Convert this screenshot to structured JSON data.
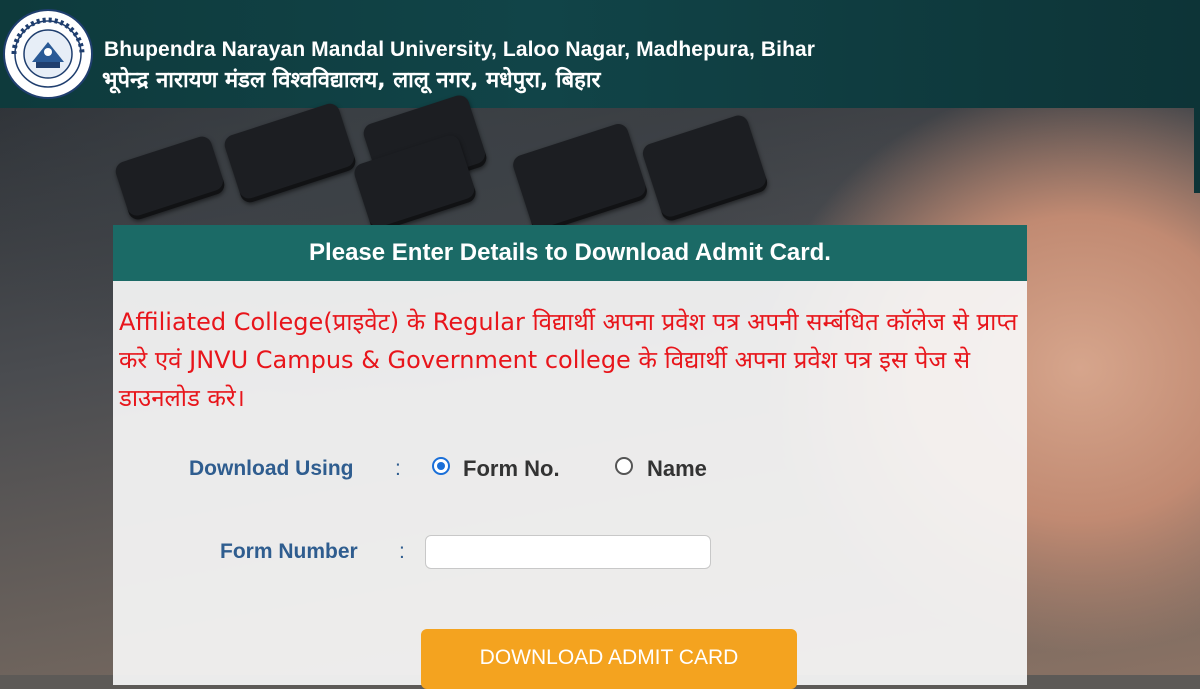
{
  "header": {
    "title_en": "Bhupendra Narayan Mandal University, Laloo Nagar, Madhepura, Bihar",
    "title_hi": "भूपेन्द्र नारायण मंडल विश्वविद्यालय, लालू  नगर, मधेपुरा, बिहार",
    "logo_icon": "university-seal-icon"
  },
  "form": {
    "heading": "Please Enter Details to Download Admit Card.",
    "notice": "Affiliated College(प्राइवेट) के Regular विद्यार्थी अपना प्रवेश पत्र अपनी सम्बंधित कॉलेज से प्राप्त करे एवं JNVU Campus & Government college के विद्यार्थी अपना प्रवेश पत्र इस पेज से डाउनलोड करे।",
    "download_using_label": "Download Using",
    "colon": ":",
    "options": [
      {
        "label": "Form No.",
        "checked": true
      },
      {
        "label": "Name",
        "checked": false
      }
    ],
    "form_number_label": "Form Number",
    "form_number_value": "",
    "button_label": "DOWNLOAD ADMIT CARD"
  },
  "colors": {
    "header_bg": "#114448",
    "panel_head_bg": "#1b6a66",
    "notice_text": "#e8151b",
    "label_text": "#2f5d8f",
    "button_bg": "#f4a31f"
  }
}
